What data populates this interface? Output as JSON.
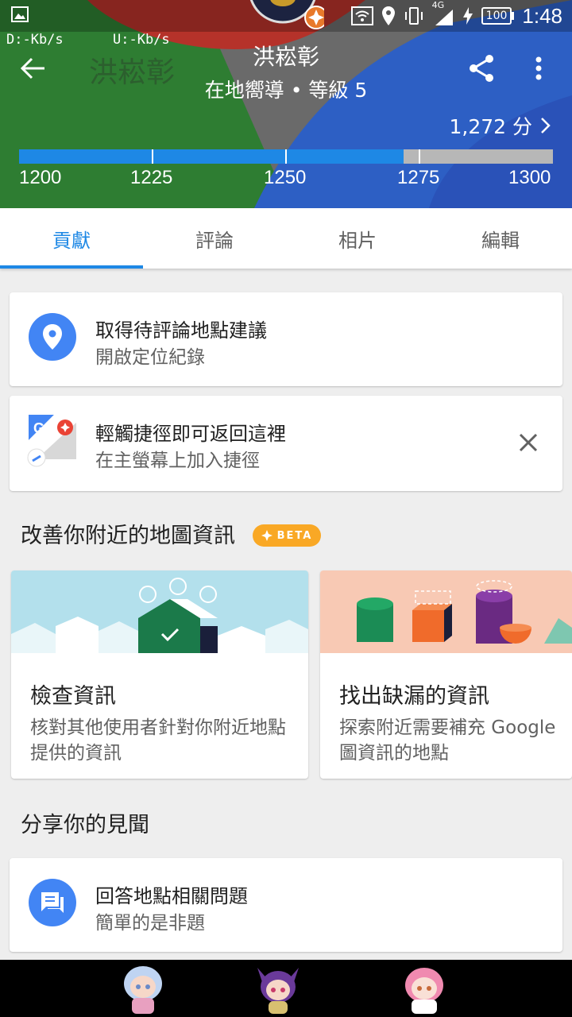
{
  "status_bar": {
    "network": "4G",
    "battery": "100",
    "time": "1:48",
    "download": "D:-Kb/s",
    "upload": "U:-Kb/s"
  },
  "profile": {
    "name": "洪崧彰",
    "level": "在地嚮導 • 等級 5",
    "points": "1,272 分",
    "progress_fraction": 0.72,
    "scale": [
      "1200",
      "1225",
      "1250",
      "1275",
      "1300"
    ]
  },
  "tabs": [
    {
      "label": "貢獻",
      "active": true
    },
    {
      "label": "評論",
      "active": false
    },
    {
      "label": "相片",
      "active": false
    },
    {
      "label": "編輯",
      "active": false
    }
  ],
  "location_card": {
    "title": "取得待評論地點建議",
    "subtitle": "開啟定位紀錄"
  },
  "shortcut_card": {
    "title": "輕觸捷徑即可返回這裡",
    "subtitle": "在主螢幕上加入捷徑"
  },
  "improve_section": {
    "title": "改善你附近的地圖資訊",
    "badge": "BETA"
  },
  "check_card": {
    "title": "檢查資訊",
    "desc": "核對其他使用者針對你附近地點提供的資訊"
  },
  "missing_card": {
    "title": "找出缺漏的資訊",
    "desc": "探索附近需要補充 Google 圖資訊的地點"
  },
  "share_section": {
    "title": "分享你的見聞"
  },
  "answer_card": {
    "title": "回答地點相關問題",
    "subtitle": "簡單的是非題"
  },
  "colors": {
    "accent": "#1e88e5",
    "icon_blue": "#4285f4",
    "beta": "#f9a825"
  }
}
